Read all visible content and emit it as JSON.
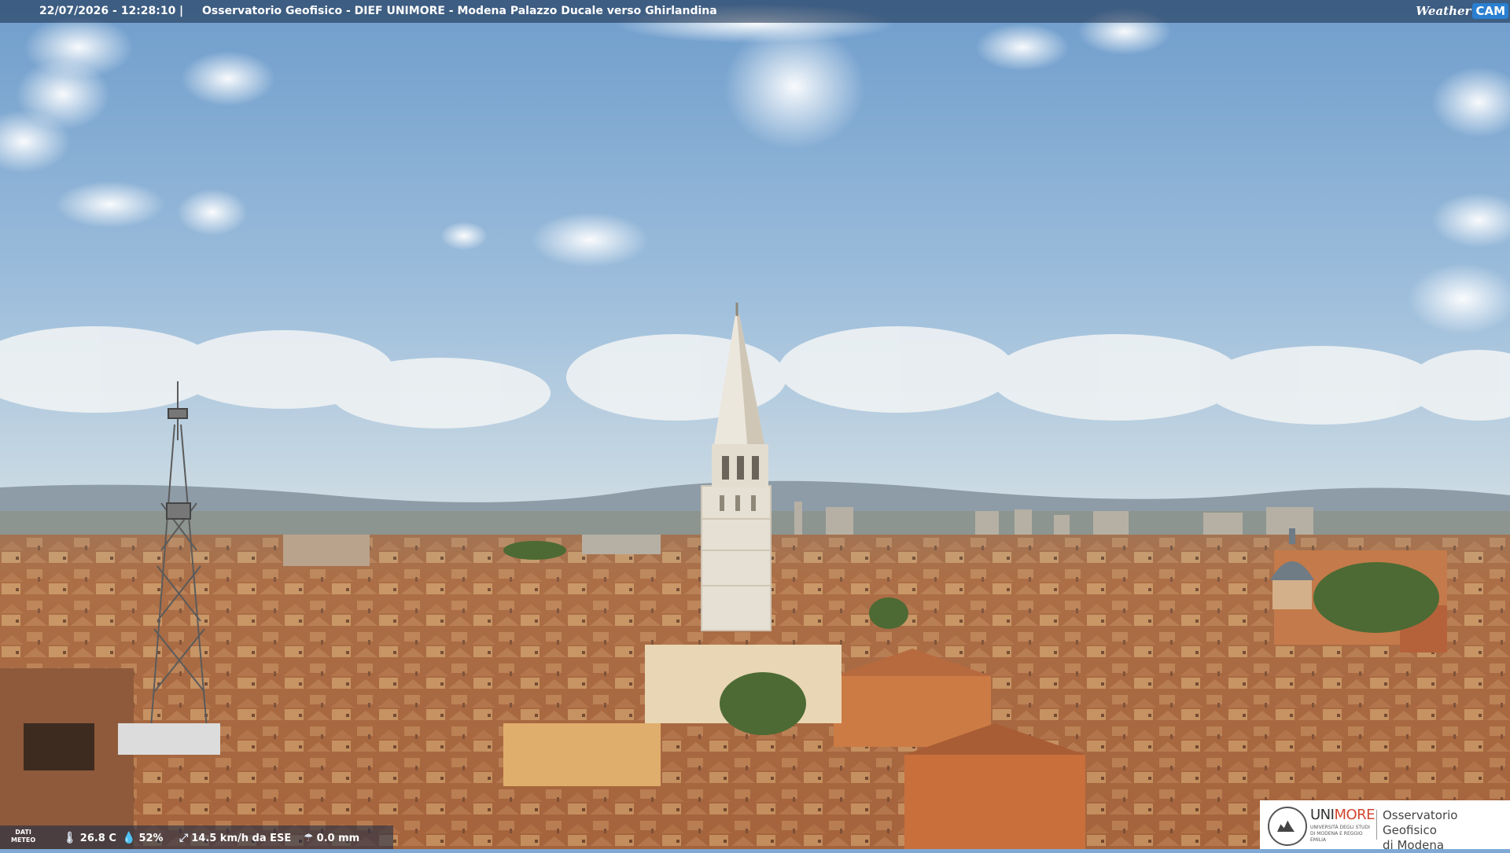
{
  "header": {
    "timestamp": "22/07/2026 - 12:28:10",
    "separator": "|",
    "title": "Osservatorio Geofisico - DIEF UNIMORE - Modena Palazzo Ducale verso Ghirlandina",
    "brand_weather": "Weather",
    "brand_cam": "CAM"
  },
  "weather": {
    "label_line1": "DATI",
    "label_line2": "METEO",
    "temperature": "26.8 C",
    "humidity": "52%",
    "wind": "14.5 km/h da ESE",
    "rain": "0.0 mm",
    "icons": [
      "thermometer-icon",
      "humidity-drop-icon",
      "wind-icon",
      "rain-gauge-icon"
    ]
  },
  "logo": {
    "uni_prefix": "UNI",
    "uni_suffix": "MORE",
    "uni_sub": "UNIVERSITÀ DEGLI STUDI DI MODENA E REGGIO EMILIA",
    "obs_line1": "Osservatorio Geofisico",
    "obs_line2": "di Modena"
  },
  "colors": {
    "sky_top": "#6f9dcc",
    "sky_horizon": "#c9d9e4",
    "roofs": "#b3704a",
    "tower": "#e6e0d4",
    "unimore_red": "#d2462d"
  }
}
